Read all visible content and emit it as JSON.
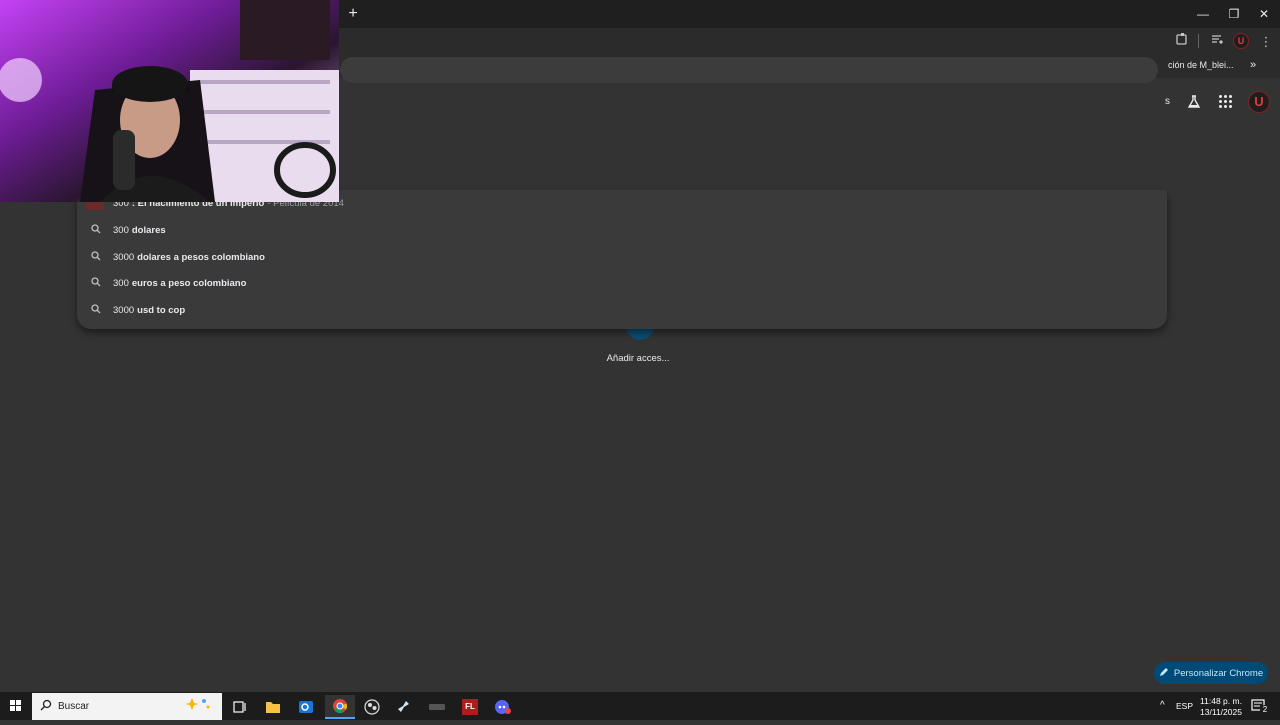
{
  "titlebar": {
    "new_tab": "+",
    "minimize": "—",
    "restore": "❐",
    "close": "✕"
  },
  "toolbar": {
    "icons": [
      "extensions-icon",
      "media-control-icon",
      "profile-icon",
      "menu-icon"
    ],
    "profile_letter": "U"
  },
  "bookmarks": {
    "item": "ción de M_blei...",
    "more": "»"
  },
  "ntp": {
    "partial_text": "s",
    "avatar_letter": "U",
    "shortcut_label": "Añadir acces...",
    "customize_label": "Personalizar Chrome"
  },
  "suggestions": [
    {
      "prefix": "300",
      "bold": ": El nacimiento de un imperio",
      "desc": "- Película de 2014",
      "icon": "movie-thumbnail"
    },
    {
      "prefix": "300",
      "bold": "dolares",
      "icon": "search-icon"
    },
    {
      "prefix": "3000",
      "bold": "dolares a pesos colombiano",
      "icon": "search-icon"
    },
    {
      "prefix": "300",
      "bold": "euros a peso colombiano",
      "icon": "search-icon"
    },
    {
      "prefix": "3000",
      "bold": "usd to cop",
      "icon": "search-icon"
    }
  ],
  "taskbar": {
    "search_placeholder": "Buscar",
    "apps": [
      "task-view-icon",
      "file-explorer-icon",
      "outlook-icon",
      "chrome-icon",
      "obs-icon",
      "steam-icon",
      "app-icon",
      "fl-studio-icon",
      "discord-icon"
    ],
    "fl_label": "FL",
    "lang": "ESP",
    "time": "11:48 p. m.",
    "date": "13/11/2025",
    "notifications": "2"
  },
  "colors": {
    "page_bg": "#333333",
    "accent": "#004a77",
    "taskbar": "#1c1c1c"
  }
}
